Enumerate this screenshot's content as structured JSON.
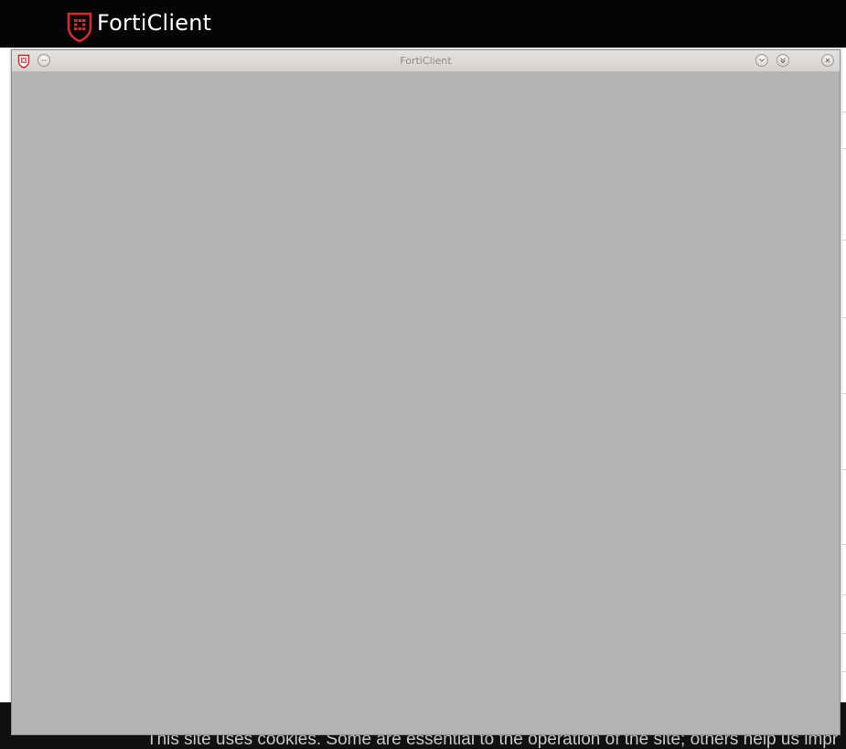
{
  "site": {
    "brand_name": "FortiClient",
    "logo_icon": "forticlient-shield-icon",
    "colors": {
      "header_bg": "#050505",
      "logo_red": "#d72c2c",
      "banner_bg": "#111111"
    }
  },
  "cookie_banner": {
    "text": "This site uses cookies. Some are essential to the operation of the site; others help us impr"
  },
  "dialog": {
    "title": "FortiClient",
    "app_icon": "forticlient-shield-icon",
    "buttons": {
      "menu": "window-menu-icon",
      "shade": "chevron-down-icon",
      "maximize": "double-chevron-down-icon",
      "close": "close-icon"
    },
    "content_state": "blank"
  }
}
